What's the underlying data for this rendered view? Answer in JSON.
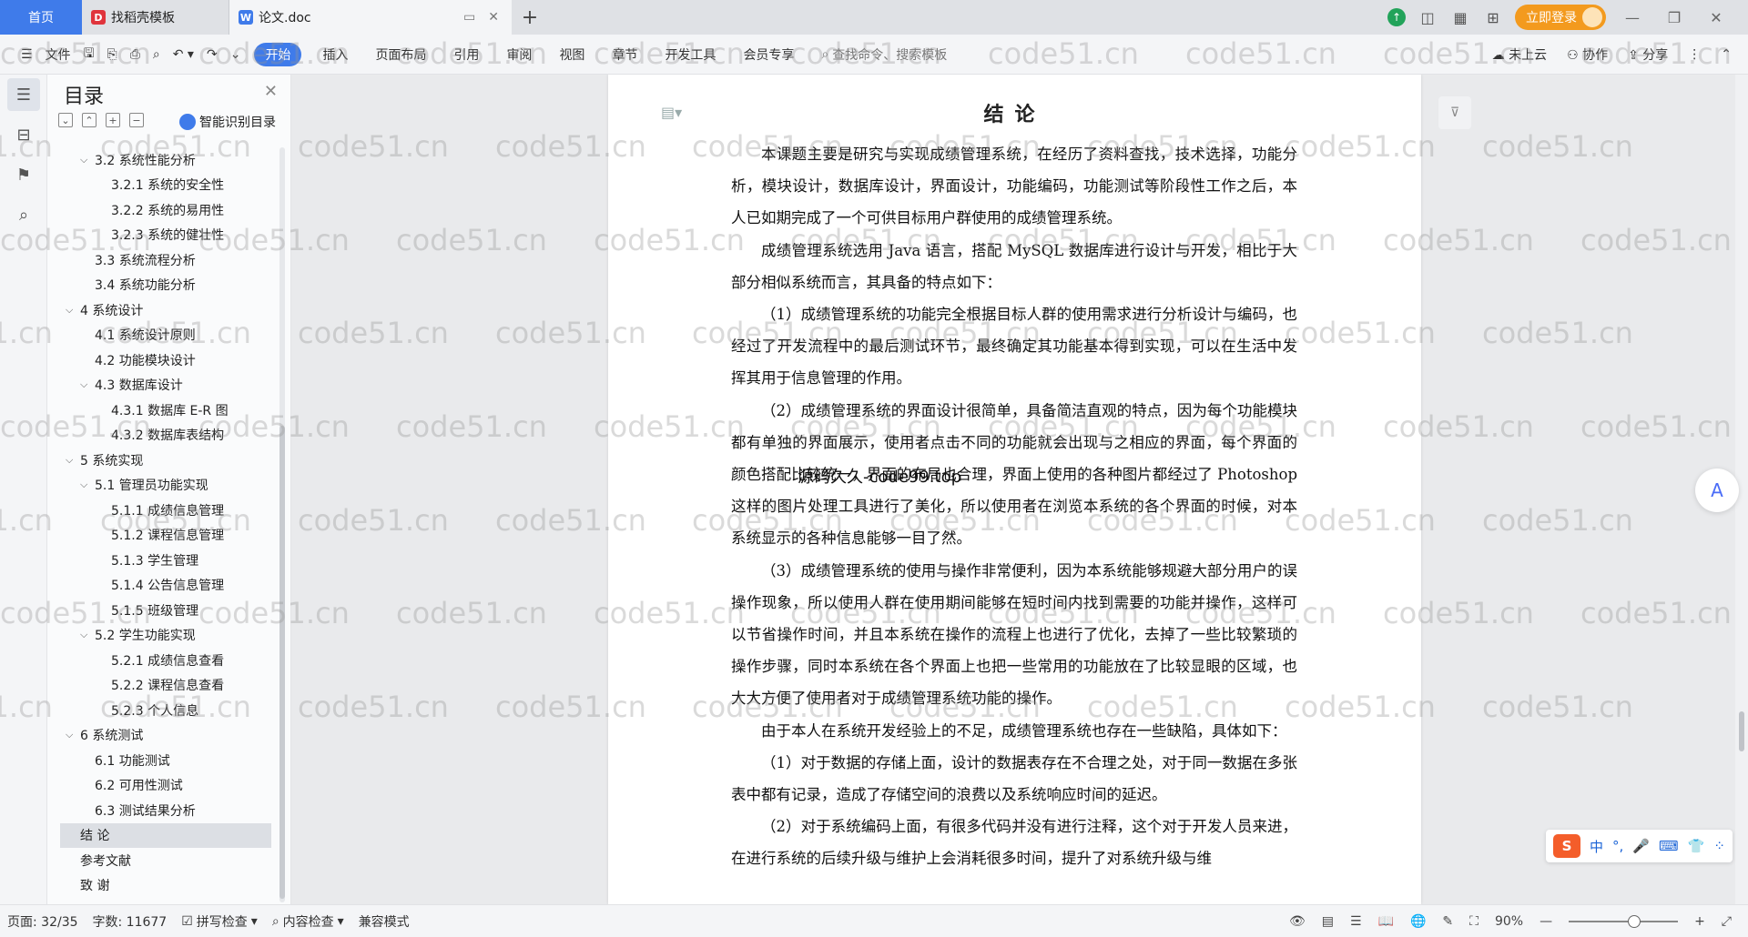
{
  "tabs": {
    "home": "首页",
    "template": "找稻壳模板",
    "doc": "论文.doc"
  },
  "titlebar": {
    "login": "立即登录"
  },
  "ribbon": {
    "file": "文件",
    "tabs": [
      "开始",
      "插入",
      "页面布局",
      "引用",
      "审阅",
      "视图",
      "章节",
      "开发工具",
      "会员专享"
    ],
    "search": "查找命令、搜索模板",
    "cloud": "未上云",
    "collab": "协作",
    "share": "分享"
  },
  "toc": {
    "title": "目录",
    "smart": "智能识别目录",
    "items": [
      {
        "text": "3.2  系统性能分析",
        "level": 2,
        "caret": "﹀"
      },
      {
        "text": "3.2.1  系统的安全性",
        "level": 3
      },
      {
        "text": "3.2.2  系统的易用性",
        "level": 3
      },
      {
        "text": "3.2.3  系统的健壮性",
        "level": 3
      },
      {
        "text": "3.3  系统流程分析",
        "level": 2
      },
      {
        "text": "3.4  系统功能分析",
        "level": 2
      },
      {
        "text": "4  系统设计",
        "level": 1,
        "caret": "﹀"
      },
      {
        "text": "4.1  系统设计原则",
        "level": 2
      },
      {
        "text": "4.2  功能模块设计",
        "level": 2
      },
      {
        "text": "4.3  数据库设计",
        "level": 2,
        "caret": "﹀"
      },
      {
        "text": "4.3.1  数据库 E-R 图",
        "level": 3
      },
      {
        "text": "4.3.2  数据库表结构",
        "level": 3
      },
      {
        "text": "5  系统实现",
        "level": 1,
        "caret": "﹀"
      },
      {
        "text": "5.1  管理员功能实现",
        "level": 2,
        "caret": "﹀"
      },
      {
        "text": "5.1.1  成绩信息管理",
        "level": 3
      },
      {
        "text": "5.1.2  课程信息管理",
        "level": 3
      },
      {
        "text": "5.1.3  学生管理",
        "level": 3
      },
      {
        "text": "5.1.4  公告信息管理",
        "level": 3
      },
      {
        "text": "5.1.5  班级管理",
        "level": 3
      },
      {
        "text": "5.2  学生功能实现",
        "level": 2,
        "caret": "﹀"
      },
      {
        "text": "5.2.1  成绩信息查看",
        "level": 3
      },
      {
        "text": "5.2.2  课程信息查看",
        "level": 3
      },
      {
        "text": "5.2.3  个人信息",
        "level": 3
      },
      {
        "text": "6  系统测试",
        "level": 1,
        "caret": "﹀"
      },
      {
        "text": "6.1  功能测试",
        "level": 2
      },
      {
        "text": "6.2  可用性测试",
        "level": 2
      },
      {
        "text": "6.3  测试结果分析",
        "level": 2
      },
      {
        "text": "结    论",
        "level": 1,
        "active": true
      },
      {
        "text": "参考文献",
        "level": 1
      },
      {
        "text": "致    谢",
        "level": 1
      }
    ]
  },
  "document": {
    "heading": "结论",
    "paragraphs": [
      "本课题主要是研究与实现成绩管理系统，在经历了资料查找，技术选择，功能分析，模块设计，数据库设计，界面设计，功能编码，功能测试等阶段性工作之后，本人已如期完成了一个可供目标用户群使用的成绩管理系统。",
      "成绩管理系统选用 Java 语言，搭配 MySQL 数据库进行设计与开发，相比于大部分相似系统而言，其具备的特点如下：",
      "（1）成绩管理系统的功能完全根据目标人群的使用需求进行分析设计与编码，也经过了开发流程中的最后测试环节，最终确定其功能基本得到实现，可以在生活中发挥其用于信息管理的作用。",
      "（2）成绩管理系统的界面设计很简单，具备简洁直观的特点，因为每个功能模块都有单独的界面展示，使用者点击不同的功能就会出现与之相应的界面，每个界面的颜色搭配比较统一，界面的布局也合理，界面上使用的各种图片都经过了 Photoshop 这样的图片处理工具进行了美化，所以使用者在浏览本系统的各个界面的时候，对本系统显示的各种信息能够一目了然。",
      "（3）成绩管理系统的使用与操作非常便利，因为本系统能够规避大部分用户的误操作现象，所以使用人群在使用期间能够在短时间内找到需要的功能并操作，这样可以节省操作时间，并且本系统在操作的流程上也进行了优化，去掉了一些比较繁琐的操作步骤，同时本系统在各个界面上也把一些常用的功能放在了比较显眼的区域，也大大方便了使用者对于成绩管理系统功能的操作。",
      "由于本人在系统开发经验上的不足，成绩管理系统也存在一些缺陷，具体如下：",
      "（1）对于数据的存储上面，设计的数据表存在不合理之处，对于同一数据在多张表中都有记录，造成了存储空间的浪费以及系统响应时间的延迟。",
      "（2）对于系统编码上面，有很多代码并没有进行注释，这个对于开发人员来进，在进行系统的后续升级与维护上会消耗很多时间，提升了对系统升级与维"
    ],
    "overlay": "源码久久-code99.top"
  },
  "ime": {
    "lang": "中",
    "punct": "°,"
  },
  "status": {
    "page": "页面: 32/35",
    "words": "字数: 11677",
    "spell": "拼写检查",
    "content": "内容检查",
    "compat": "兼容模式",
    "zoom": "90%",
    "zoom_level": 0.6
  },
  "watermark": "code51.cn",
  "colors": {
    "accent": "#3f7bea",
    "login": "#f39a1e"
  }
}
